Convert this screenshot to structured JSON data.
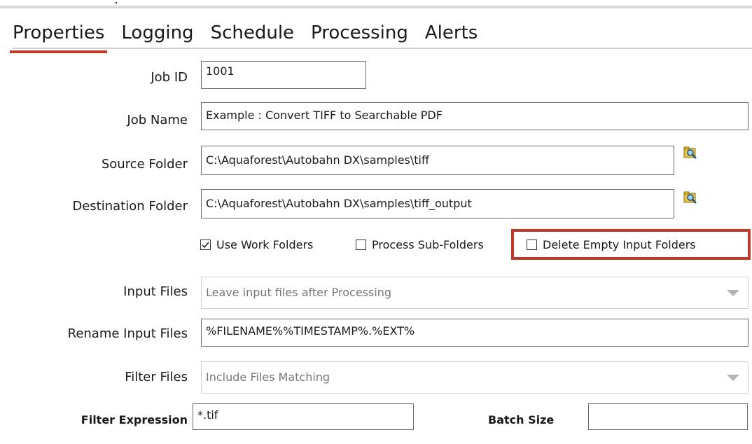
{
  "tabs": [
    {
      "label": "Properties",
      "active": true
    },
    {
      "label": "Logging",
      "active": false
    },
    {
      "label": "Schedule",
      "active": false
    },
    {
      "label": "Processing",
      "active": false
    },
    {
      "label": "Alerts",
      "active": false
    }
  ],
  "form": {
    "job_id": {
      "label": "Job ID",
      "value": "1001"
    },
    "job_name": {
      "label": "Job Name",
      "value": "Example : Convert TIFF to Searchable PDF"
    },
    "source_folder": {
      "label": "Source Folder",
      "value": "C:\\Aquaforest\\Autobahn DX\\samples\\tiff"
    },
    "destination_folder": {
      "label": "Destination Folder",
      "value": "C:\\Aquaforest\\Autobahn DX\\samples\\tiff_output"
    },
    "checkboxes": {
      "use_work_folders": {
        "label": "Use Work Folders",
        "checked": true
      },
      "process_sub_folders": {
        "label": "Process Sub-Folders",
        "checked": false
      },
      "delete_empty_input_folders": {
        "label": "Delete Empty Input Folders",
        "checked": false
      }
    },
    "input_files": {
      "label": "Input Files",
      "value": "Leave input files after Processing"
    },
    "rename_input_files": {
      "label": "Rename Input Files",
      "value": "%FILENAME%%TIMESTAMP%.%EXT%"
    },
    "filter_files": {
      "label": "Filter Files",
      "value": "Include Files Matching"
    },
    "filter_expression": {
      "label": "Filter Expression",
      "value": "*.tif"
    },
    "batch_size": {
      "label": "Batch Size",
      "value": ""
    }
  },
  "colors": {
    "accent": "#c0392b",
    "highlight": "#c0392b"
  },
  "icons": {
    "browse": "folder-search-icon",
    "dropdown": "chevron-down-icon"
  }
}
